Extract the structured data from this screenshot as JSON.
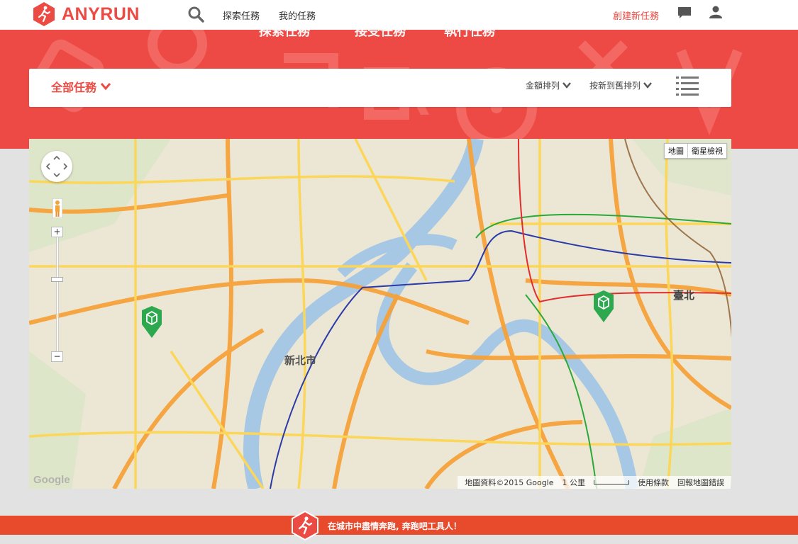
{
  "app": {
    "brand": "ANYRUN",
    "brand_color": "#ec4b44"
  },
  "topnav": {
    "explore": "探索任務",
    "my_tasks": "我的任務",
    "create": "創建新任務",
    "icons": [
      "search-icon",
      "chat-icon",
      "user-icon"
    ]
  },
  "hero": {
    "tabs": [
      "探索任務",
      "接受任務",
      "執行任務"
    ],
    "background_color": "#ee4a45"
  },
  "filter": {
    "all_tasks": "全部任務",
    "sort_amount": "金額排列",
    "sort_date": "按新到舊排列"
  },
  "map": {
    "type_map": "地圖",
    "type_satellite": "衛星檢視",
    "city_label": "新北市",
    "city_label_2": "臺北",
    "zoom_in": "+",
    "zoom_out": "−",
    "logo": "Google",
    "attribution": "地圖資料©2015 Google",
    "scale_label": "1 公里",
    "terms": "使用條款",
    "report": "回報地圖錯誤",
    "markers": 2
  },
  "footer": {
    "slogan": "在城市中盡情奔跑, 奔跑吧工具人！",
    "color": "#e84a2c"
  }
}
